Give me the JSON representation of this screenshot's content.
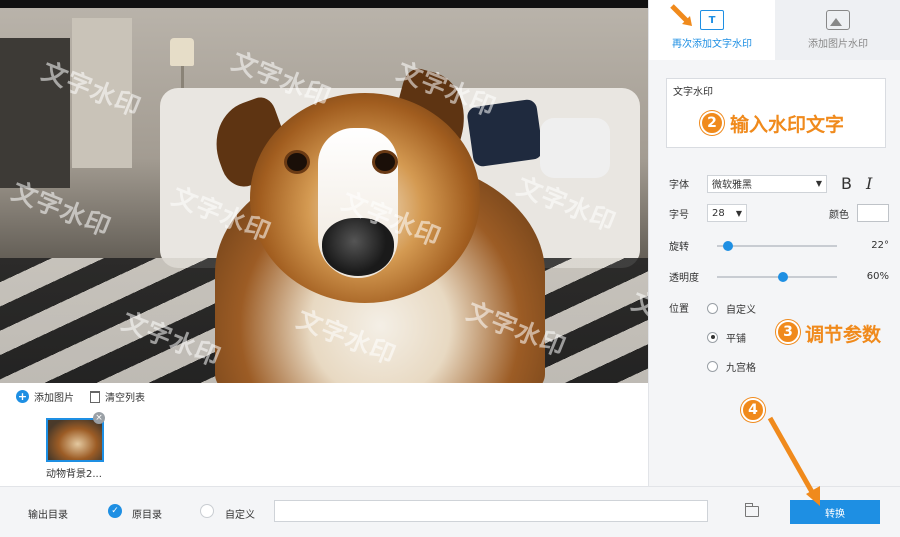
{
  "tabs": [
    {
      "label": "再次添加文字水印",
      "icon": "text-watermark-icon",
      "active": true
    },
    {
      "label": "添加图片水印",
      "icon": "image-watermark-icon",
      "active": false
    }
  ],
  "text_box": {
    "value": "文字水印"
  },
  "watermark_text": "文字水印",
  "font": {
    "label": "字体",
    "value": "微软雅黑",
    "bold": "B",
    "italic": "I"
  },
  "size": {
    "label": "字号",
    "value": "28",
    "color_label": "颜色",
    "color_value": "#ffffff"
  },
  "rotation": {
    "label": "旋转",
    "value": "22°",
    "fraction": 0.05
  },
  "opacity": {
    "label": "透明度",
    "value": "60%",
    "fraction": 0.55
  },
  "position": {
    "label": "位置",
    "options": [
      {
        "label": "自定义",
        "selected": false
      },
      {
        "label": "平铺",
        "selected": true
      },
      {
        "label": "九宫格",
        "selected": false
      }
    ]
  },
  "annotations": {
    "step2_num": "2",
    "step2_text": "输入水印文字",
    "step3_num": "3",
    "step3_text": "调节参数",
    "step4_num": "4"
  },
  "toolbar": {
    "add_image": "添加图片",
    "clear_list": "清空列表"
  },
  "thumbnail": {
    "name": "动物背景2..."
  },
  "output": {
    "label": "输出目录",
    "original": "原目录",
    "custom": "自定义",
    "path": ""
  },
  "convert_button": "转换",
  "colors": {
    "accent": "#1e8fe3",
    "annotation": "#f08a1c"
  }
}
